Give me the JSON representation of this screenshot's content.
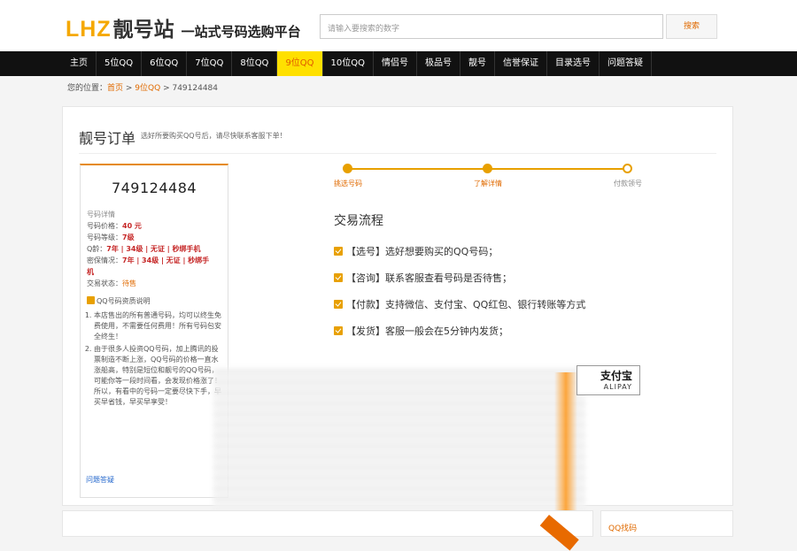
{
  "header": {
    "logo_lhz": "LHZ",
    "logo_cn": "靓号站",
    "logo_sub": "一站式号码选购平台",
    "search_placeholder": "请输入要搜索的数字",
    "search_button": "搜索"
  },
  "nav": {
    "items": [
      "主页",
      "5位QQ",
      "6位QQ",
      "7位QQ",
      "8位QQ",
      "9位QQ",
      "10位QQ",
      "情侣号",
      "极品号",
      "靓号",
      "信誉保证",
      "目录选号",
      "问题答疑"
    ],
    "active_index": 5
  },
  "breadcrumb": {
    "prefix": "您的位置：",
    "home": "首页",
    "sep1": " > ",
    "category": "9位QQ",
    "sep2": " > ",
    "current": "749124484"
  },
  "order": {
    "title": "靓号订单",
    "tip": "选好所要购买QQ号后，请尽快联系客服下单！"
  },
  "card": {
    "number": "749124484",
    "details_header": "号码详情",
    "price_label": "号码价格：",
    "price_value": "40 元",
    "level_label": "号码等级：",
    "level_value": "7级",
    "q_label": "Q龄：",
    "q_value": "7年 | 34级 | 无证 | 秒绑手机",
    "security_label": "密保情况：",
    "security_value_1": "7年 | 34级 | 无证 | 秒绑手",
    "security_value_2": "机",
    "status_label": "交易状态：",
    "status_value": "待售",
    "notes_title": "QQ号码资质说明",
    "notes": [
      "本店售出的所有普通号码，均可以终生免费使用，不需要任何费用！所有号码包安全终生！",
      "由于很多人投资QQ号码，加上腾讯的投票制造不断上涨，QQ号码的价格一直水涨船高，特别是短位和靓号的QQ号码，可能你等一段时间看，会发现价格涨了！所以，有看中的号码一定要尽快下手，早买早省钱，早买早享受！"
    ],
    "faq": "问题答疑"
  },
  "steps": [
    "挑选号码",
    "了解详情",
    "付款领号"
  ],
  "flow": {
    "title": "交易流程",
    "items": [
      "【选号】选好想要购买的QQ号码；",
      "【咨询】联系客服查看号码是否待售；",
      "【付款】支持微信、支付宝、QQ红包、银行转账等方式",
      "【发货】客服一般会在5分钟内发货；"
    ]
  },
  "alipay": {
    "cn": "支付宝",
    "en": "ALIPAY"
  },
  "bottom": {
    "right_title": "QQ找码"
  },
  "colors": {
    "accent": "#e8a000",
    "link": "#e06a00",
    "nav_bg": "#111111",
    "nav_active_bg": "#ffe000"
  }
}
